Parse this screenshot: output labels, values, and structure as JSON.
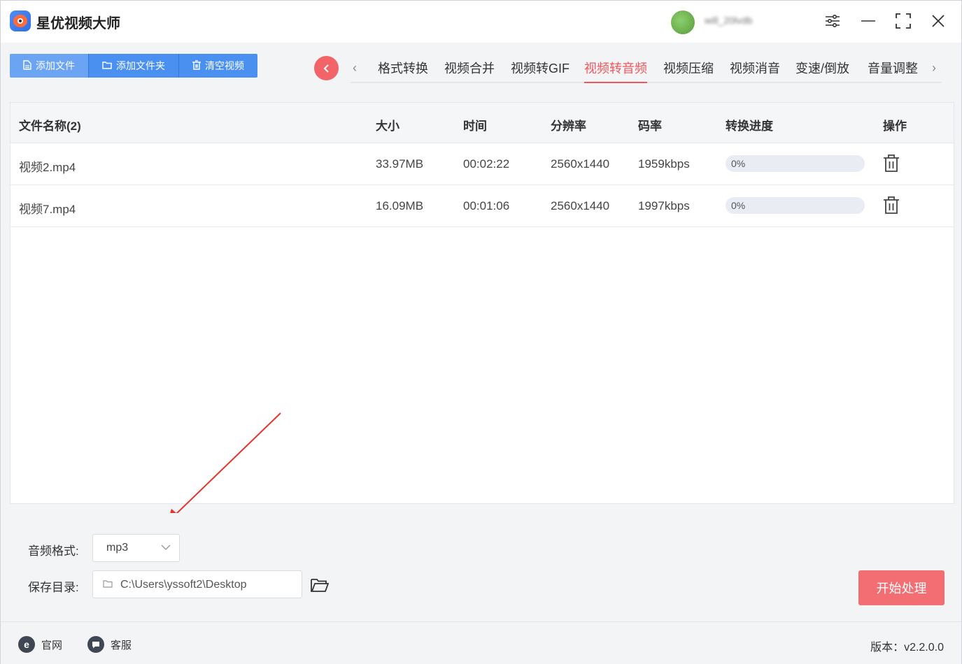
{
  "app": {
    "title": "星优视频大师"
  },
  "user": {
    "name": "will_20lvdb"
  },
  "window_controls": {
    "settings_icon": "sliders-icon",
    "minimize_icon": "minimize-icon",
    "maximize_icon": "maximize-icon",
    "close_icon": "close-icon"
  },
  "toolbar": {
    "add_file": "添加文件",
    "add_folder": "添加文件夹",
    "clear_video": "清空视频"
  },
  "tabs": [
    "格式转换",
    "视频合并",
    "视频转GIF",
    "视频转音频",
    "视频压缩",
    "视频消音",
    "变速/倒放",
    "音量调整"
  ],
  "active_tab": "视频转音频",
  "table": {
    "headers": {
      "name": "文件名称(2)",
      "size": "大小",
      "time": "时间",
      "resolution": "分辨率",
      "bitrate": "码率",
      "progress": "转换进度",
      "action": "操作"
    },
    "rows": [
      {
        "name": "视频2.mp4",
        "size": "33.97MB",
        "time": "00:02:22",
        "resolution": "2560x1440",
        "bitrate": "1959kbps",
        "progress": 0,
        "progress_label": "0%"
      },
      {
        "name": "视频7.mp4",
        "size": "16.09MB",
        "time": "00:01:06",
        "resolution": "2560x1440",
        "bitrate": "1997kbps",
        "progress": 0,
        "progress_label": "0%"
      }
    ]
  },
  "settings": {
    "audio_format_label": "音频格式:",
    "audio_format_value": "mp3",
    "save_dir_label": "保存目录:",
    "save_dir_value": "C:\\Users\\yssoft2\\Desktop",
    "start_button": "开始处理"
  },
  "footer": {
    "website": "官网",
    "support": "客服",
    "version": "版本：v2.2.0.0"
  },
  "colors": {
    "accent_blue": "#4a90f0",
    "accent_red": "#f0565b",
    "start_button": "#f26e72"
  }
}
